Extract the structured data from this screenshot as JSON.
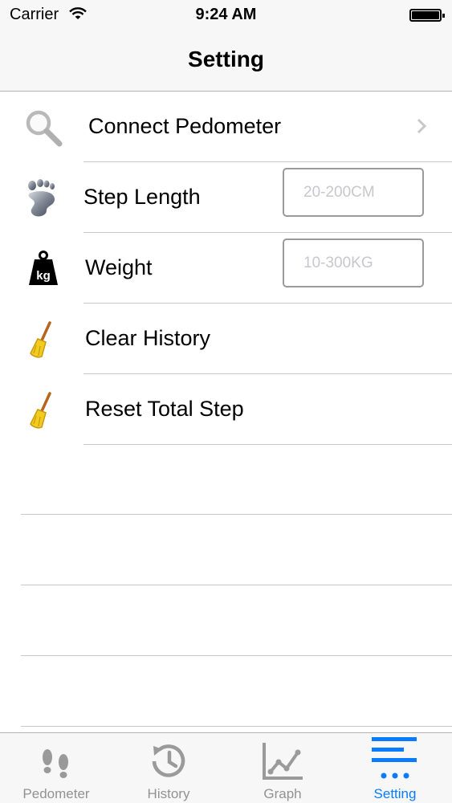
{
  "status": {
    "carrier": "Carrier",
    "time": "9:24 AM"
  },
  "nav": {
    "title": "Setting"
  },
  "rows": [
    {
      "label": "Connect Pedometer",
      "icon": "search-icon"
    },
    {
      "label": "Step Length",
      "icon": "footprint-icon",
      "input_placeholder": "20-200CM",
      "input_value": ""
    },
    {
      "label": "Weight",
      "icon": "kg-weight-icon",
      "input_placeholder": "10-300KG",
      "input_value": ""
    },
    {
      "label": "Clear History",
      "icon": "broom-icon"
    },
    {
      "label": "Reset Total Step",
      "icon": "broom-icon"
    }
  ],
  "tabs": [
    {
      "label": "Pedometer",
      "icon": "footprints-icon",
      "active": false
    },
    {
      "label": "History",
      "icon": "history-clock-icon",
      "active": false
    },
    {
      "label": "Graph",
      "icon": "line-graph-icon",
      "active": false
    },
    {
      "label": "Setting",
      "icon": "settings-list-icon",
      "active": true
    }
  ],
  "colors": {
    "accent": "#0a7bff",
    "inactive": "#929292",
    "separator": "#c8c7cc",
    "bar_background": "#f7f7f7"
  }
}
